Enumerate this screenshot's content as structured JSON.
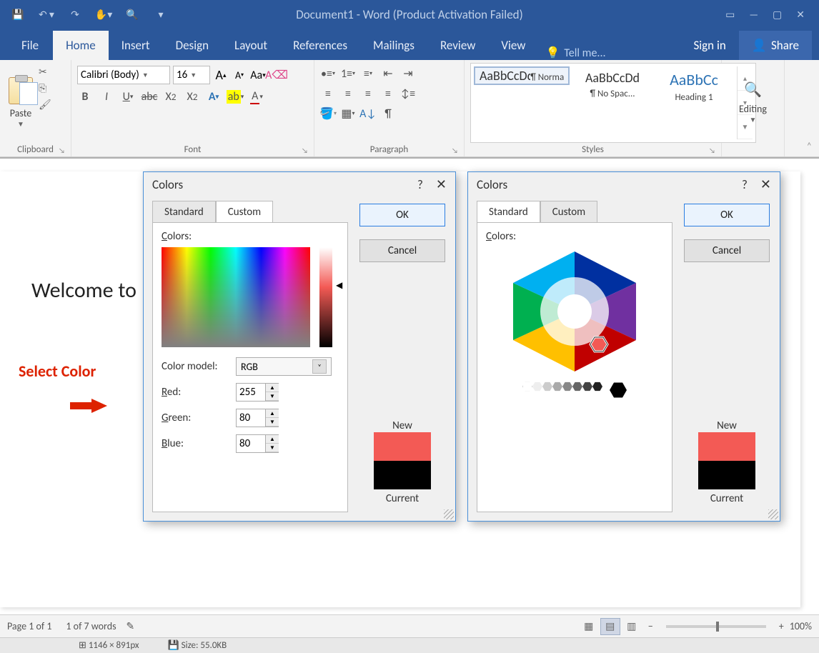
{
  "titlebar": {
    "text": "Document1 - Word (Product Activation Failed)"
  },
  "tabs": {
    "file": "File",
    "home": "Home",
    "insert": "Insert",
    "design": "Design",
    "layout": "Layout",
    "references": "References",
    "mailings": "Mailings",
    "review": "Review",
    "view": "View",
    "tellme": "Tell me...",
    "signin": "Sign in",
    "share": "Share"
  },
  "ribbon": {
    "clipboard": {
      "paste": "Paste",
      "label": "Clipboard"
    },
    "font": {
      "name": "Calibri (Body)",
      "size": "16",
      "label": "Font",
      "bold": "B",
      "italic": "I",
      "underline": "U",
      "grow": "A",
      "shrink": "A",
      "case": "Aa",
      "clear": "✎"
    },
    "paragraph": {
      "label": "Paragraph"
    },
    "styles": {
      "label": "Styles",
      "items": [
        {
          "preview": "AaBbCcDd",
          "name": "¶ Normal"
        },
        {
          "preview": "AaBbCcDd",
          "name": "¶ No Spac..."
        },
        {
          "preview": "AaBbCc",
          "name": "Heading 1"
        }
      ]
    },
    "editing": {
      "label": "Editing"
    }
  },
  "document": {
    "text": "Welcome to",
    "annotation": "Select Color"
  },
  "dialogLeft": {
    "title": "Colors",
    "help": "?",
    "close": "✕",
    "tabStandard": "Standard",
    "tabCustom": "Custom",
    "ok": "OK",
    "cancel": "Cancel",
    "colorsLabel": "Colors:",
    "modelLabel": "Color model:",
    "model": "RGB",
    "redLabel": "Red:",
    "red": "255",
    "greenLabel": "Green:",
    "green": "80",
    "blueLabel": "Blue:",
    "blue": "80",
    "newLabel": "New",
    "currentLabel": "Current"
  },
  "dialogRight": {
    "title": "Colors",
    "help": "?",
    "close": "✕",
    "tabStandard": "Standard",
    "tabCustom": "Custom",
    "ok": "OK",
    "cancel": "Cancel",
    "colorsLabel": "Colors:",
    "newLabel": "New",
    "currentLabel": "Current"
  },
  "statusbar": {
    "page": "Page 1 of 1",
    "words": "1 of 7 words",
    "zoomMinus": "−",
    "zoomPlus": "+",
    "zoom": "100%"
  },
  "infobar": {
    "dims": "1146 × 891px",
    "size": "Size: 55.0KB"
  }
}
